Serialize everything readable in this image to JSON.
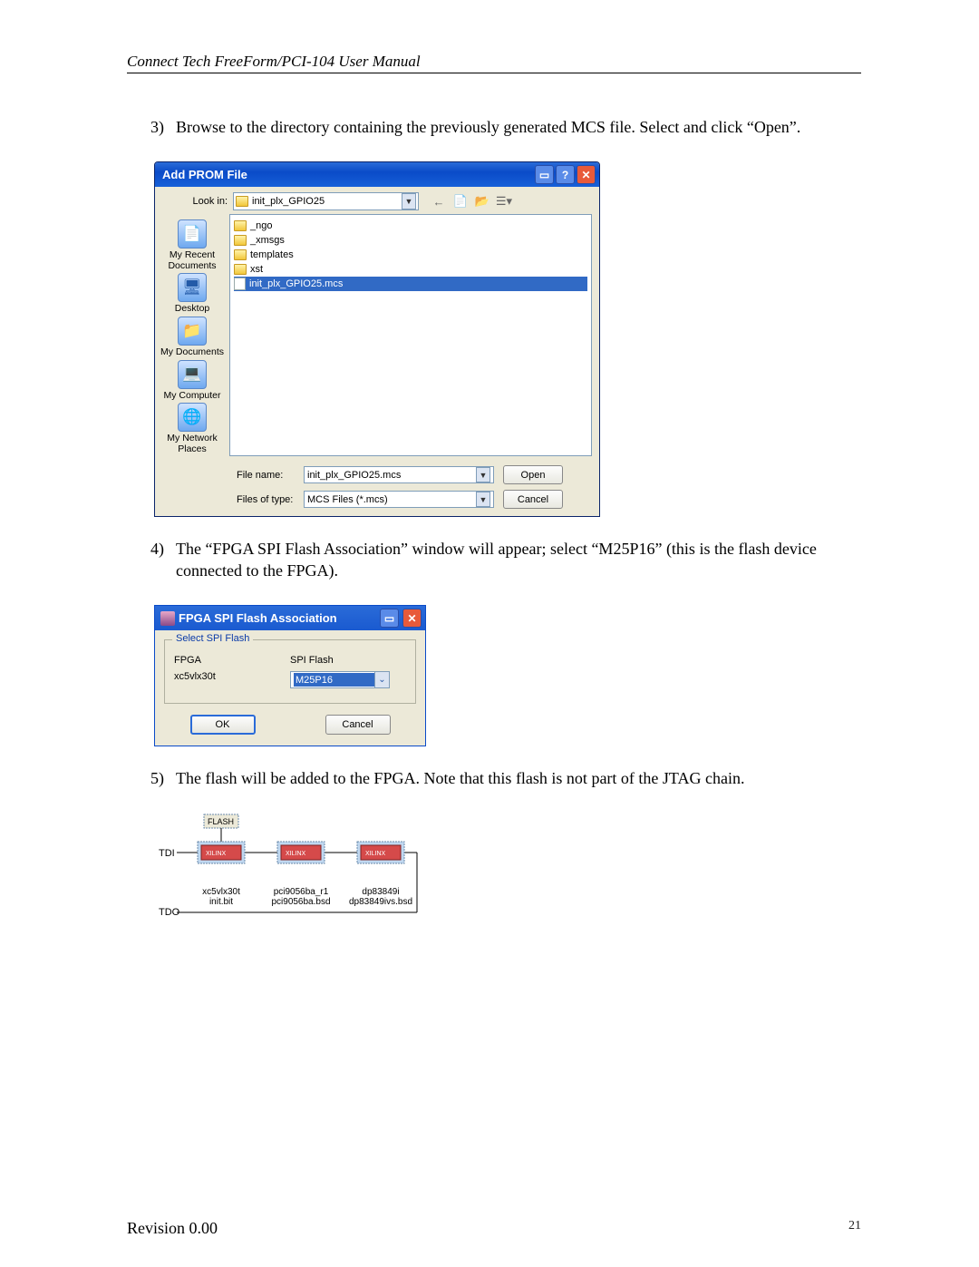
{
  "doc_header": "Connect Tech FreeForm/PCI-104 User Manual",
  "steps": {
    "s3": {
      "num": "3)",
      "txt": "Browse to the directory containing the previously generated MCS file.  Select and click “Open”."
    },
    "s4": {
      "num": "4)",
      "txt": "The “FPGA SPI Flash Association” window will appear; select “M25P16” (this is the flash device connected to the FPGA)."
    },
    "s5": {
      "num": "5)",
      "txt": "The flash will be added to the FPGA.  Note that this flash is not part of the JTAG chain."
    }
  },
  "dlg1": {
    "title": "Add PROM File",
    "lookin_label": "Look in:",
    "lookin_value": "init_plx_GPIO25",
    "files": {
      "f0": "_ngo",
      "f1": "_xmsgs",
      "f2": "templates",
      "f3": "xst",
      "f4": "init_plx_GPIO25.mcs"
    },
    "places": {
      "p0": "My Recent Documents",
      "p1": "Desktop",
      "p2": "My Documents",
      "p3": "My Computer",
      "p4": "My Network Places"
    },
    "filename_label": "File name:",
    "filename_value": "init_plx_GPIO25.mcs",
    "filetype_label": "Files of type:",
    "filetype_value": "MCS Files (*.mcs)",
    "open": "Open",
    "cancel": "Cancel"
  },
  "dlg2": {
    "title": "FPGA SPI Flash Association",
    "legend": "Select SPI Flash",
    "col_fpga": "FPGA",
    "val_fpga": "xc5vlx30t",
    "col_spi": "SPI Flash",
    "val_spi": "M25P16",
    "ok": "OK",
    "cancel": "Cancel"
  },
  "jtag": {
    "flash": "FLASH",
    "tdi": "TDI",
    "tdo": "TDO",
    "chip_brand": "XILINX",
    "chip1_l1": "xc5vlx30t",
    "chip1_l2": "init.bit",
    "chip2_l1": "pci9056ba_r1",
    "chip2_l2": "pci9056ba.bsd",
    "chip3_l1": "dp83849i",
    "chip3_l2": "dp83849ivs.bsd"
  },
  "footer": {
    "revision": "Revision 0.00",
    "page": "21"
  }
}
